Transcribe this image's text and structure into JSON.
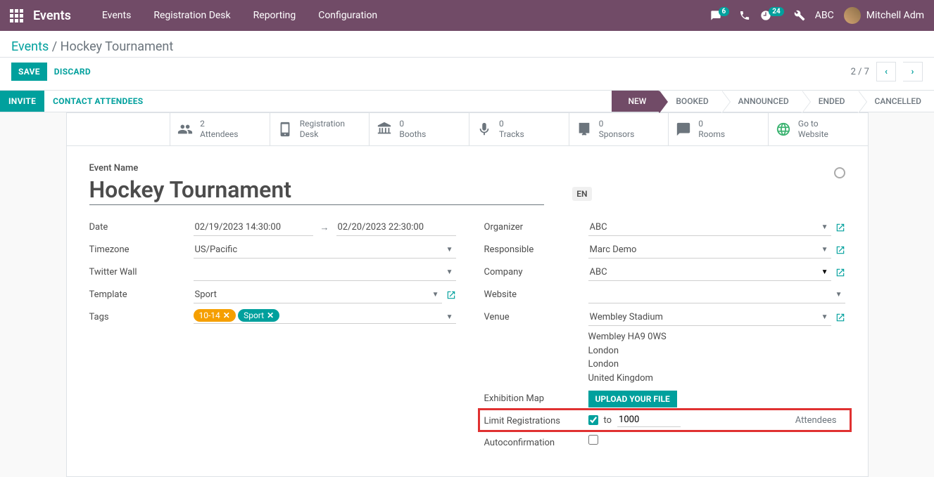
{
  "topbar": {
    "app_title": "Events",
    "nav": [
      "Events",
      "Registration Desk",
      "Reporting",
      "Configuration"
    ],
    "msg_badge": "6",
    "activity_badge": "24",
    "company": "ABC",
    "user": "Mitchell Adm"
  },
  "breadcrumb": {
    "root": "Events",
    "sep": " / ",
    "current": "Hockey Tournament"
  },
  "actions": {
    "save": "SAVE",
    "discard": "DISCARD"
  },
  "pager": {
    "text": "2 / 7"
  },
  "statusbar": {
    "invite": "INVITE",
    "contact": "CONTACT ATTENDEES",
    "stages": [
      "NEW",
      "BOOKED",
      "ANNOUNCED",
      "ENDED",
      "CANCELLED"
    ]
  },
  "stats": {
    "attendees": {
      "n": "2",
      "label": "Attendees"
    },
    "regdesk": {
      "l1": "Registration",
      "l2": "Desk"
    },
    "booths": {
      "n": "0",
      "label": "Booths"
    },
    "tracks": {
      "n": "0",
      "label": "Tracks"
    },
    "sponsors": {
      "n": "0",
      "label": "Sponsors"
    },
    "rooms": {
      "n": "0",
      "label": "Rooms"
    },
    "website": {
      "l1": "Go to",
      "l2": "Website"
    }
  },
  "form": {
    "name_label": "Event Name",
    "name": "Hockey Tournament",
    "lang": "EN",
    "date_label": "Date",
    "date_start": "02/19/2023 14:30:00",
    "date_end": "02/20/2023 22:30:00",
    "tz_label": "Timezone",
    "tz": "US/Pacific",
    "twitter_label": "Twitter Wall",
    "template_label": "Template",
    "template": "Sport",
    "tags_label": "Tags",
    "tags": [
      {
        "text": "10-14",
        "color": "#f59f00"
      },
      {
        "text": "Sport",
        "color": "#00A09D"
      }
    ],
    "organizer_label": "Organizer",
    "organizer": "ABC",
    "responsible_label": "Responsible",
    "responsible": "Marc Demo",
    "company_label": "Company",
    "company": "ABC",
    "website_label": "Website",
    "venue_label": "Venue",
    "venue": "Wembley Stadium",
    "addr": [
      "Wembley HA9 0WS",
      "London",
      "London",
      "United Kingdom"
    ],
    "exmap_label": "Exhibition Map",
    "upload": "UPLOAD YOUR FILE",
    "limit_label": "Limit Registrations",
    "limit_to": "to",
    "limit_val": "1000",
    "limit_suffix": "Attendees",
    "autoconf_label": "Autoconfirmation"
  }
}
